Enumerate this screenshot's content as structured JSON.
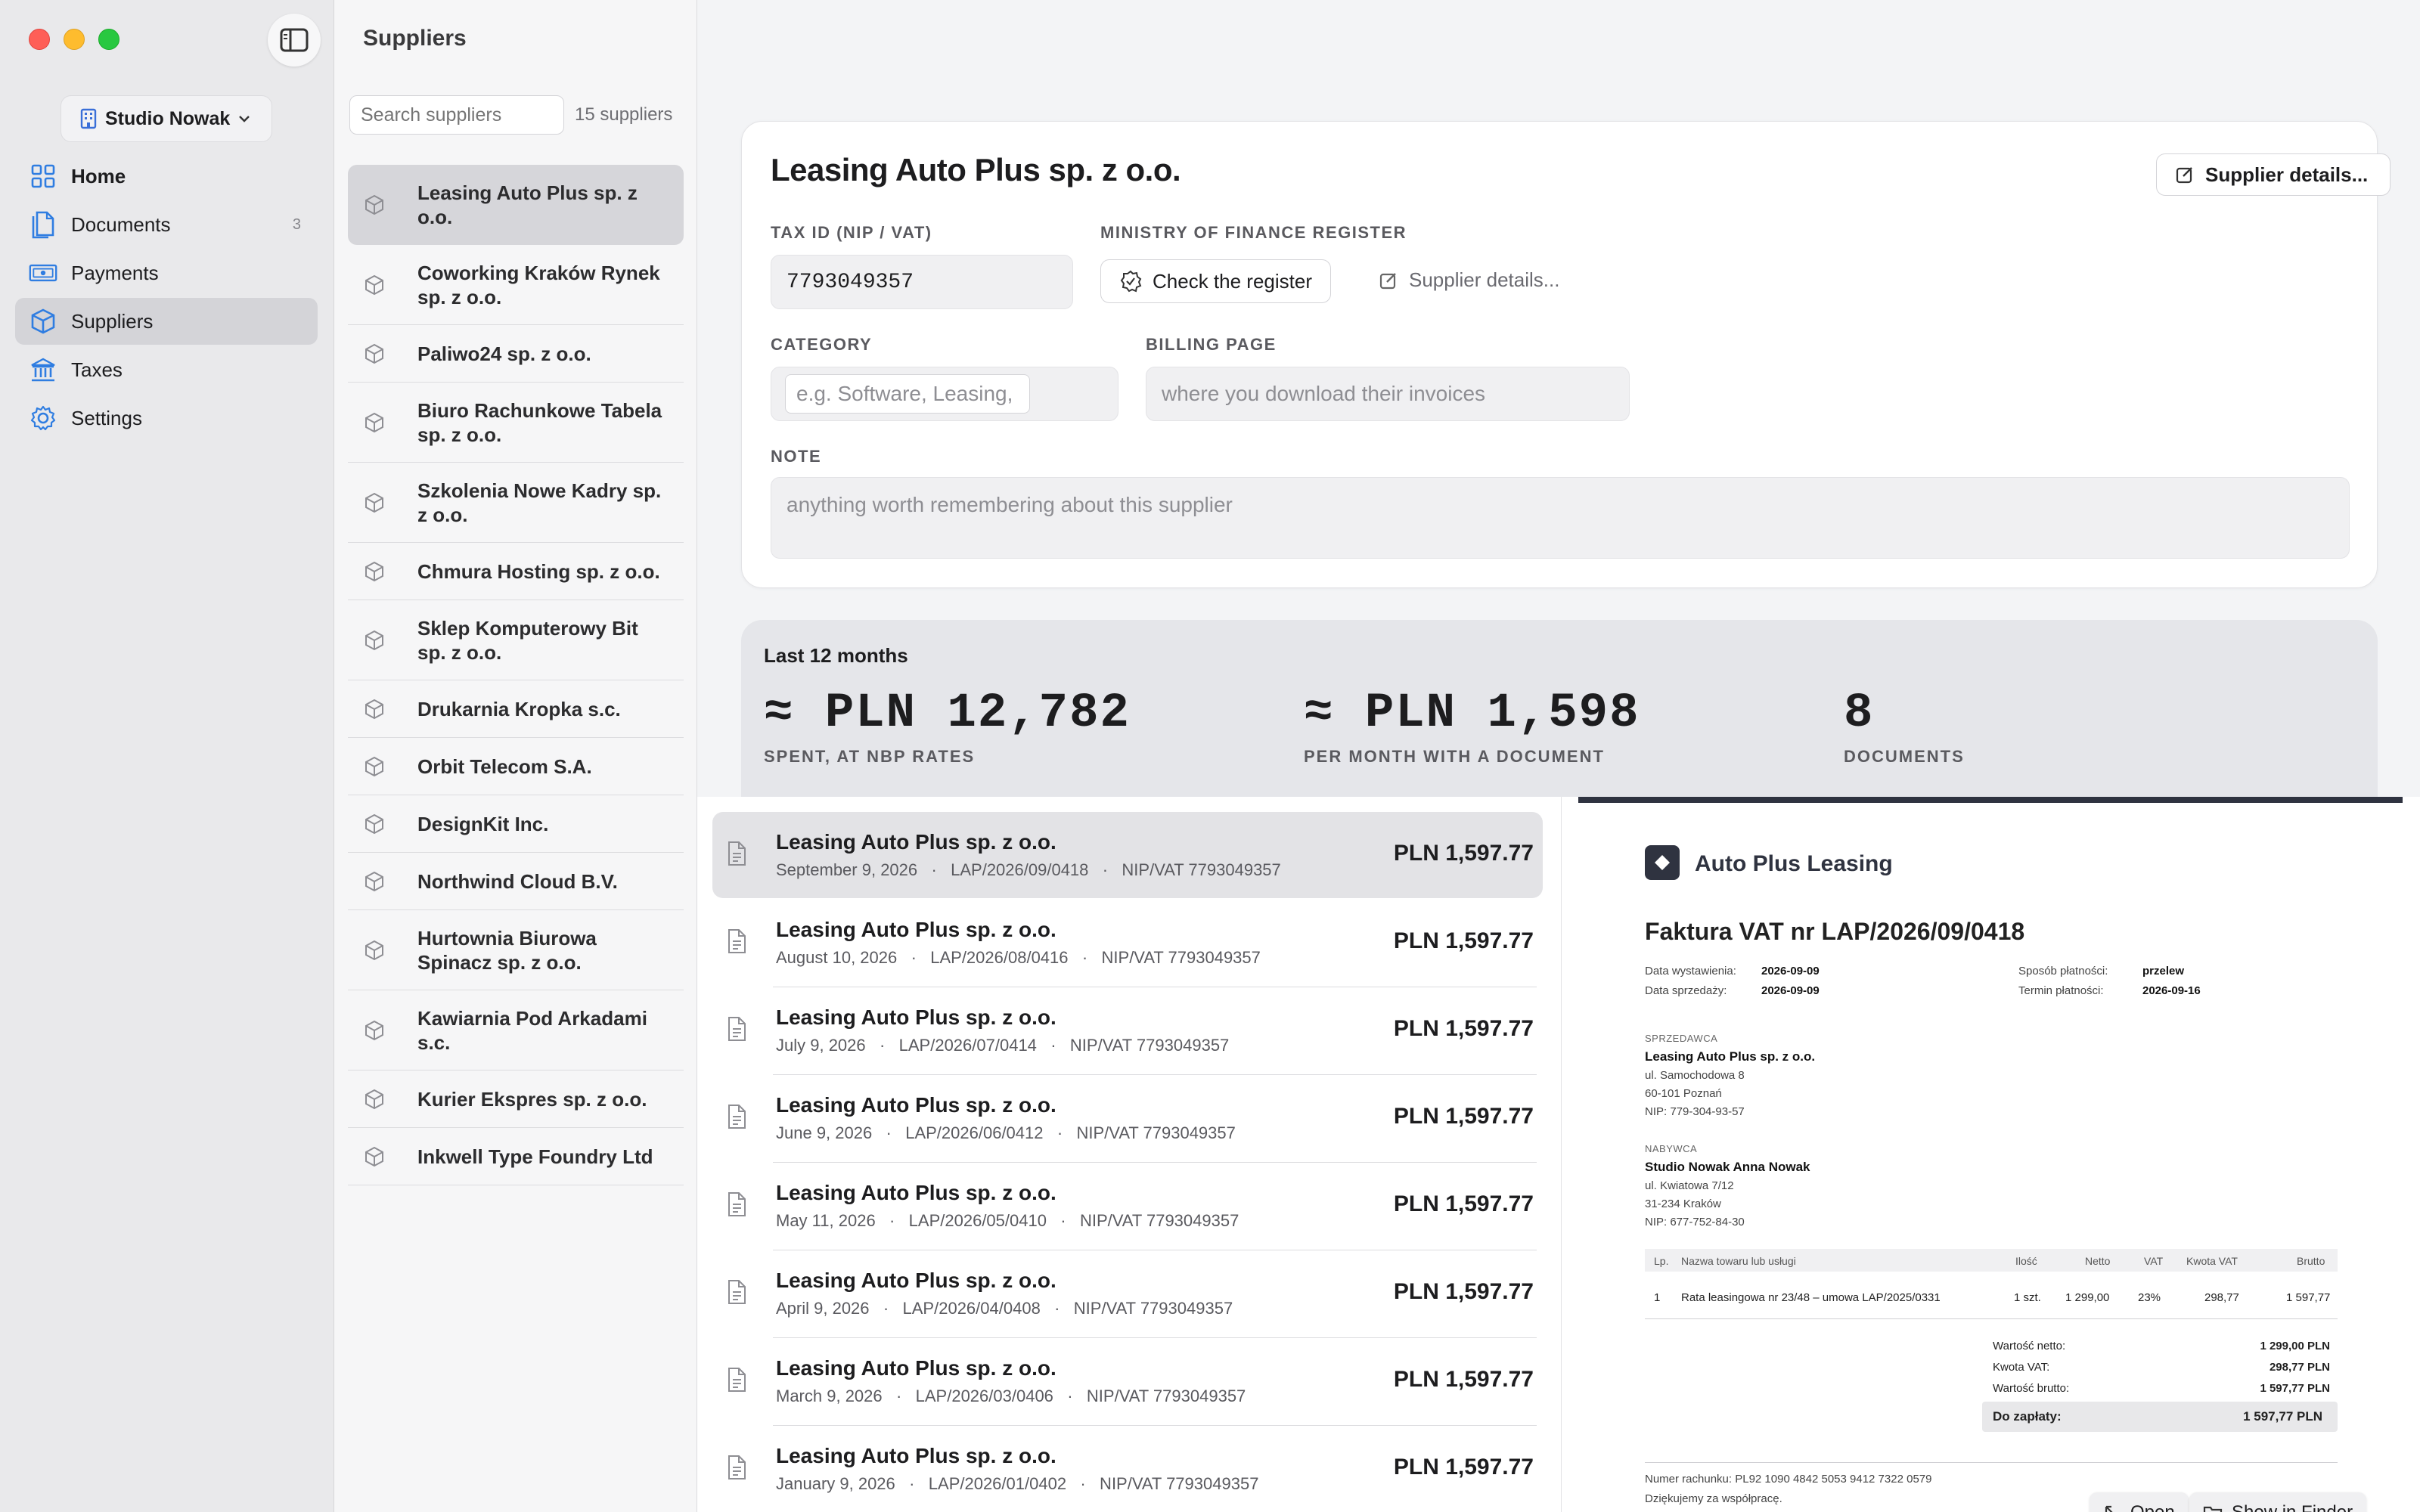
{
  "sidebar": {
    "workspace": "Studio Nowak",
    "items": [
      {
        "label": "Home",
        "icon": "grid-icon",
        "badge": ""
      },
      {
        "label": "Documents",
        "icon": "documents-icon",
        "badge": "3"
      },
      {
        "label": "Payments",
        "icon": "banknote-icon",
        "badge": ""
      },
      {
        "label": "Suppliers",
        "icon": "box-icon",
        "badge": ""
      },
      {
        "label": "Taxes",
        "icon": "bank-building-icon",
        "badge": ""
      },
      {
        "label": "Settings",
        "icon": "gear-icon",
        "badge": ""
      }
    ]
  },
  "list": {
    "title": "Suppliers",
    "search_placeholder": "Search suppliers",
    "count": "15 suppliers",
    "suppliers": [
      "Leasing Auto Plus sp. z o.o.",
      "Coworking Kraków Rynek sp. z o.o.",
      "Paliwo24 sp. z o.o.",
      "Biuro Rachunkowe Tabela sp. z o.o.",
      "Szkolenia Nowe Kadry sp. z o.o.",
      "Chmura Hosting sp. z o.o.",
      "Sklep Komputerowy Bit sp. z o.o.",
      "Drukarnia Kropka s.c.",
      "Orbit Telecom S.A.",
      "DesignKit Inc.",
      "Northwind Cloud B.V.",
      "Hurtownia Biurowa Spinacz sp. z o.o.",
      "Kawiarnia Pod Arkadami s.c.",
      "Kurier Ekspres sp. z o.o.",
      "Inkwell Type Foundry Ltd"
    ]
  },
  "detail": {
    "title": "Leasing Auto Plus sp. z o.o.",
    "details_button": "Supplier details...",
    "tax_id_label": "TAX ID (NIP / VAT)",
    "tax_id_value": "7793049357",
    "register_label": "MINISTRY OF FINANCE REGISTER",
    "check_register_button": "Check the register",
    "supplier_details_link": "Supplier details...",
    "category_label": "CATEGORY",
    "category_placeholder": "e.g. Software, Leasing,",
    "billing_label": "BILLING PAGE",
    "billing_placeholder": "where you download their invoices",
    "note_label": "NOTE",
    "note_placeholder": "anything worth remembering about this supplier"
  },
  "stats": {
    "heading": "Last 12 months",
    "spent_value": "≈ PLN 12,782",
    "spent_label": "SPENT, AT NBP RATES",
    "monthly_value": "≈ PLN 1,598",
    "monthly_label": "PER MONTH WITH A DOCUMENT",
    "docs_value": "8",
    "docs_label": "DOCUMENTS"
  },
  "documents": [
    {
      "name": "Leasing Auto Plus sp. z o.o.",
      "meta": "September 9, 2026   ·   LAP/2026/09/0418   ·   NIP/VAT 7793049357",
      "amount": "PLN 1,597.77"
    },
    {
      "name": "Leasing Auto Plus sp. z o.o.",
      "meta": "August 10, 2026   ·   LAP/2026/08/0416   ·   NIP/VAT 7793049357",
      "amount": "PLN 1,597.77"
    },
    {
      "name": "Leasing Auto Plus sp. z o.o.",
      "meta": "July 9, 2026   ·   LAP/2026/07/0414   ·   NIP/VAT 7793049357",
      "amount": "PLN 1,597.77"
    },
    {
      "name": "Leasing Auto Plus sp. z o.o.",
      "meta": "June 9, 2026   ·   LAP/2026/06/0412   ·   NIP/VAT 7793049357",
      "amount": "PLN 1,597.77"
    },
    {
      "name": "Leasing Auto Plus sp. z o.o.",
      "meta": "May 11, 2026   ·   LAP/2026/05/0410   ·   NIP/VAT 7793049357",
      "amount": "PLN 1,597.77"
    },
    {
      "name": "Leasing Auto Plus sp. z o.o.",
      "meta": "April 9, 2026   ·   LAP/2026/04/0408   ·   NIP/VAT 7793049357",
      "amount": "PLN 1,597.77"
    },
    {
      "name": "Leasing Auto Plus sp. z o.o.",
      "meta": "March 9, 2026   ·   LAP/2026/03/0406   ·   NIP/VAT 7793049357",
      "amount": "PLN 1,597.77"
    },
    {
      "name": "Leasing Auto Plus sp. z o.o.",
      "meta": "January 9, 2026   ·   LAP/2026/01/0402   ·   NIP/VAT 7793049357",
      "amount": "PLN 1,597.77"
    }
  ],
  "invoice": {
    "brand": "Auto Plus Leasing",
    "title": "Faktura VAT nr LAP/2026/09/0418",
    "issue_label": "Data wystawienia:",
    "issue_date": "2026-09-09",
    "sale_label": "Data sprzedaży:",
    "sale_date": "2026-09-09",
    "pay_method_label": "Sposób płatności:",
    "pay_method": "przelew",
    "due_label": "Termin płatności:",
    "due_date": "2026-09-16",
    "seller_label": "SPRZEDAWCA",
    "seller_name": "Leasing Auto Plus sp. z o.o.",
    "seller_street": "ul. Samochodowa 8",
    "seller_city": "60-101 Poznań",
    "seller_nip": "NIP: 779-304-93-57",
    "buyer_label": "NABYWCA",
    "buyer_name": "Studio Nowak Anna Nowak",
    "buyer_street": "ul. Kwiatowa 7/12",
    "buyer_city": "31-234 Kraków",
    "buyer_nip": "NIP: 677-752-84-30",
    "cols": {
      "lp": "Lp.",
      "name": "Nazwa towaru lub usługi",
      "qty": "Ilość",
      "net": "Netto",
      "vat": "VAT",
      "vat_amount": "Kwota VAT",
      "gross": "Brutto"
    },
    "row": {
      "lp": "1",
      "name": "Rata leasingowa nr 23/48 – umowa LAP/2025/0331",
      "qty": "1 szt.",
      "net": "1 299,00",
      "vat": "23%",
      "vat_amount": "298,77",
      "gross": "1 597,77"
    },
    "net_total_label": "Wartość netto:",
    "net_total": "1 299,00 PLN",
    "vat_total_label": "Kwota VAT:",
    "vat_total": "298,77 PLN",
    "gross_total_label": "Wartość brutto:",
    "gross_total": "1 597,77 PLN",
    "to_pay_label": "Do zapłaty:",
    "to_pay": "1 597,77 PLN",
    "account": "Numer rachunku: PL92 1090 4842 5053 9412 7322 0579",
    "thanks": "Dziękujemy za współpracę."
  },
  "preview_actions": {
    "open": "Open",
    "finder": "Show in Finder"
  }
}
